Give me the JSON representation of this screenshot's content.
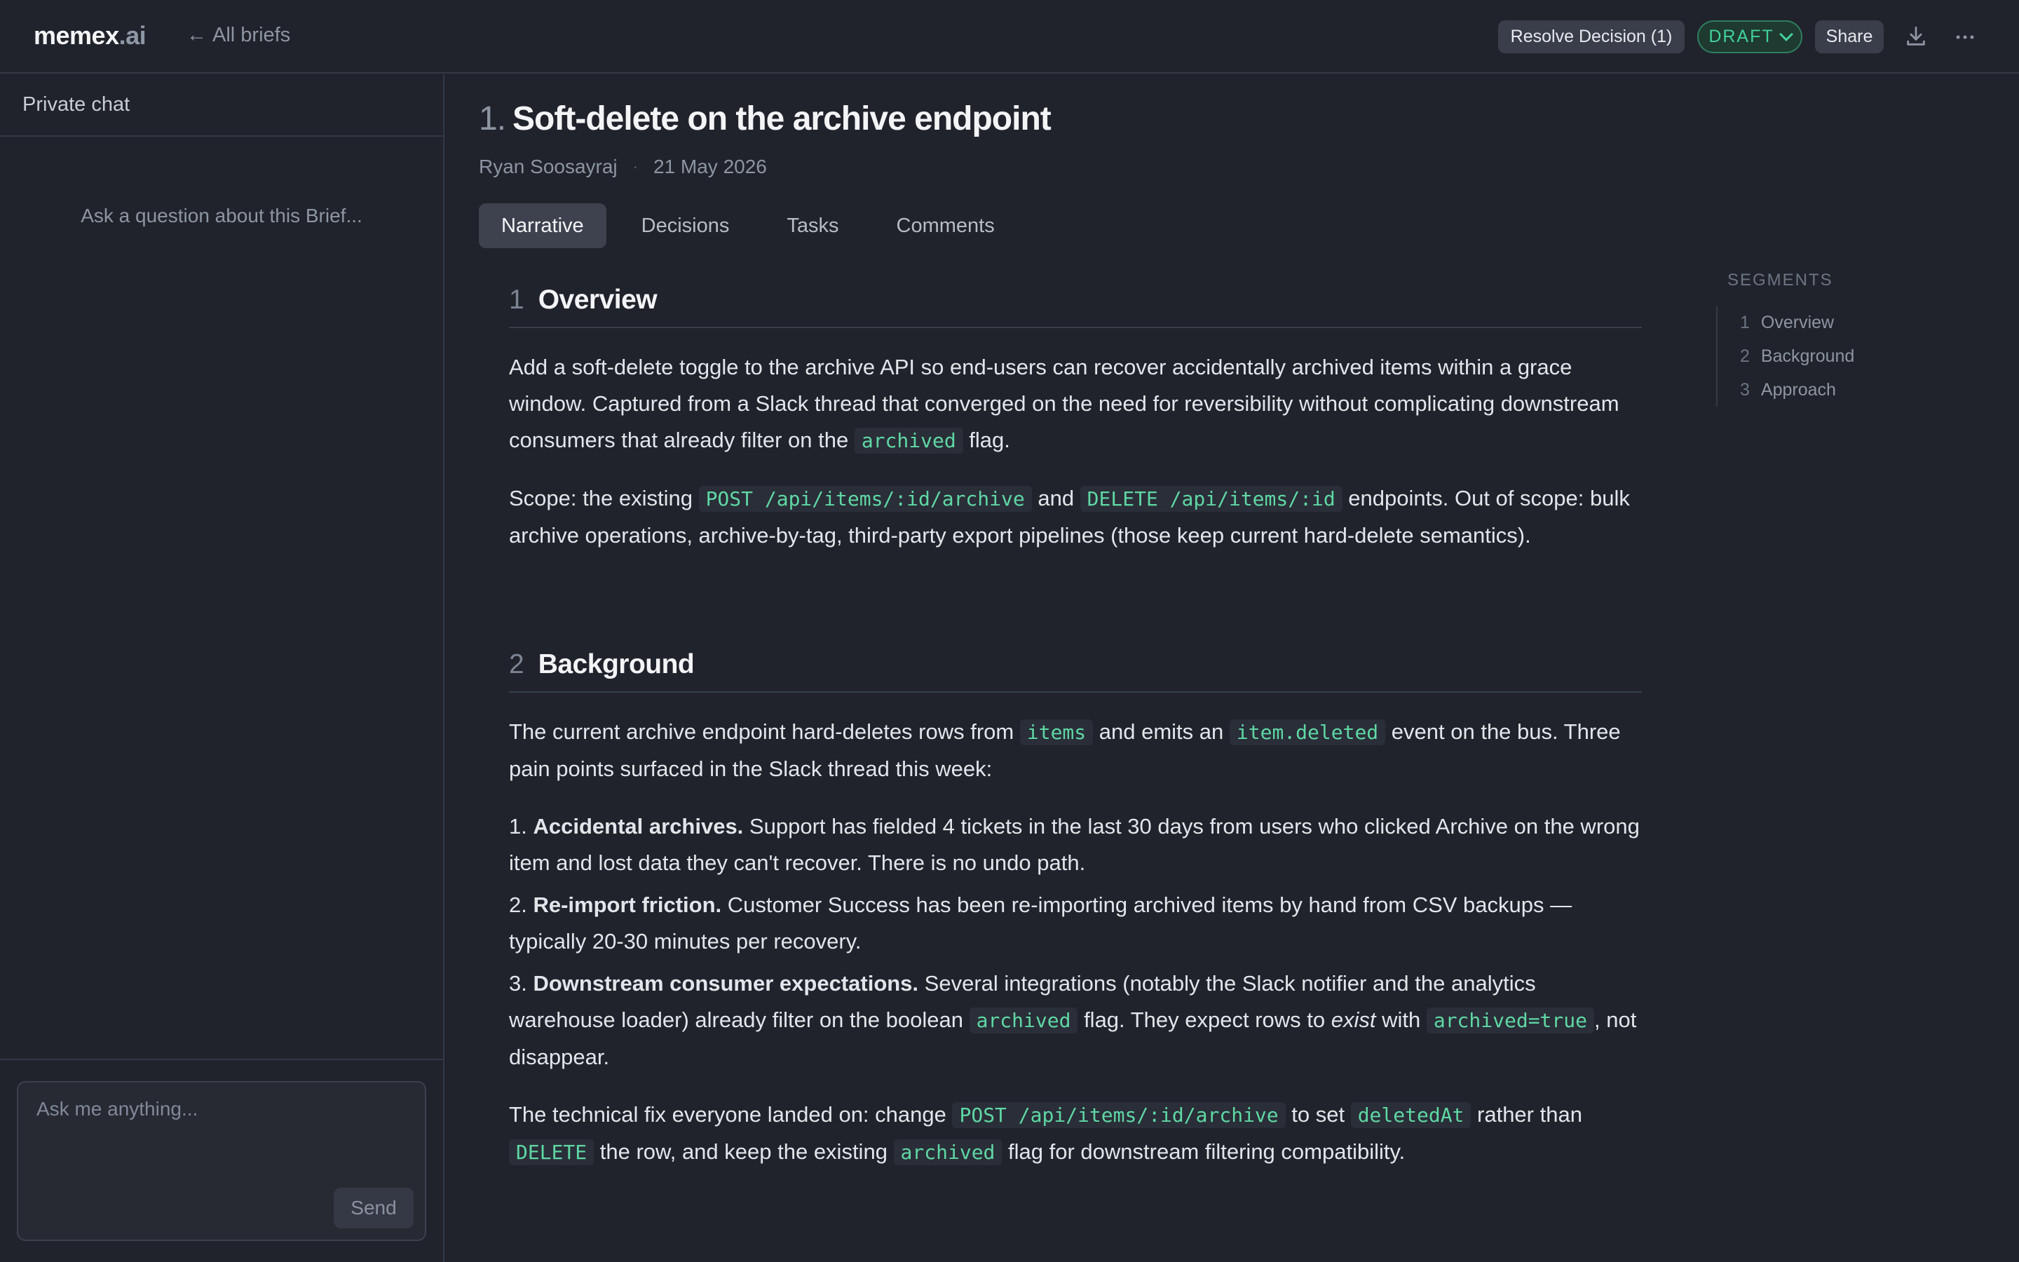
{
  "app": {
    "logo_main": "memex",
    "logo_suffix": ".ai",
    "back_label": "All briefs"
  },
  "toolbar": {
    "resolve_label": "Resolve Decision (1)",
    "status_label": "DRAFT",
    "share_label": "Share",
    "download_icon": "download-icon",
    "more_icon": "more-horizontal-icon",
    "status_color": "#41d19a"
  },
  "sidebar": {
    "title": "Private chat",
    "empty_prompt": "Ask a question about this Brief...",
    "input_placeholder": "Ask me anything...",
    "send_label": "Send"
  },
  "doc": {
    "number": "1.",
    "title": "Soft-delete on the archive endpoint",
    "author": "Ryan Soosayraj",
    "date": "21 May 2026",
    "tabs": [
      {
        "label": "Narrative",
        "active": true
      },
      {
        "label": "Decisions",
        "active": false
      },
      {
        "label": "Tasks",
        "active": false
      },
      {
        "label": "Comments",
        "active": false
      }
    ]
  },
  "sections": {
    "overview": {
      "num": "1",
      "title": "Overview",
      "p1_a": "Add a soft-delete toggle to the archive API so end-users can recover accidentally archived items within a grace window. Captured from a Slack thread that converged on the need for reversibility without complicating downstream consumers that already filter on the ",
      "p1_code": "archived",
      "p1_b": " flag.",
      "p2_a": "Scope: the existing ",
      "p2_code1": "POST /api/items/:id/archive",
      "p2_b": " and ",
      "p2_code2": "DELETE /api/items/:id",
      "p2_c": " endpoints. Out of scope: bulk archive operations, archive-by-tag, third-party export pipelines (those keep current hard-delete semantics)."
    },
    "background": {
      "num": "2",
      "title": "Background",
      "p1_a": "The current archive endpoint hard-deletes rows from ",
      "p1_code1": "items",
      "p1_b": " and emits an ",
      "p1_code2": "item.deleted",
      "p1_c": " event on the bus. Three pain points surfaced in the Slack thread this week:",
      "li1_num": "1.",
      "li1_bold": "Accidental archives.",
      "li1_text": " Support has fielded 4 tickets in the last 30 days from users who clicked Archive on the wrong item and lost data they can't recover. There is no undo path.",
      "li2_num": "2.",
      "li2_bold": "Re-import friction.",
      "li2_text": " Customer Success has been re-importing archived items by hand from CSV backups — typically 20-30 minutes per recovery.",
      "li3_num": "3.",
      "li3_bold": "Downstream consumer expectations.",
      "li3_text_a": " Several integrations (notably the Slack notifier and the analytics warehouse loader) already filter on the boolean ",
      "li3_code1": "archived",
      "li3_text_b": " flag. They expect rows to ",
      "li3_em": "exist",
      "li3_text_c": " with ",
      "li3_code2": "archived=true",
      "li3_text_d": ", not disappear.",
      "p2_a": "The technical fix everyone landed on: change ",
      "p2_code1": "POST /api/items/:id/archive",
      "p2_b": " to set ",
      "p2_code2": "deletedAt",
      "p2_c": " rather than ",
      "p2_code3": "DELETE",
      "p2_d": " the row, and keep the existing ",
      "p2_code4": "archived",
      "p2_e": " flag for downstream filtering compatibility."
    }
  },
  "segments": {
    "title": "SEGMENTS",
    "items": [
      {
        "num": "1",
        "label": "Overview"
      },
      {
        "num": "2",
        "label": "Background"
      },
      {
        "num": "3",
        "label": "Approach"
      }
    ]
  }
}
